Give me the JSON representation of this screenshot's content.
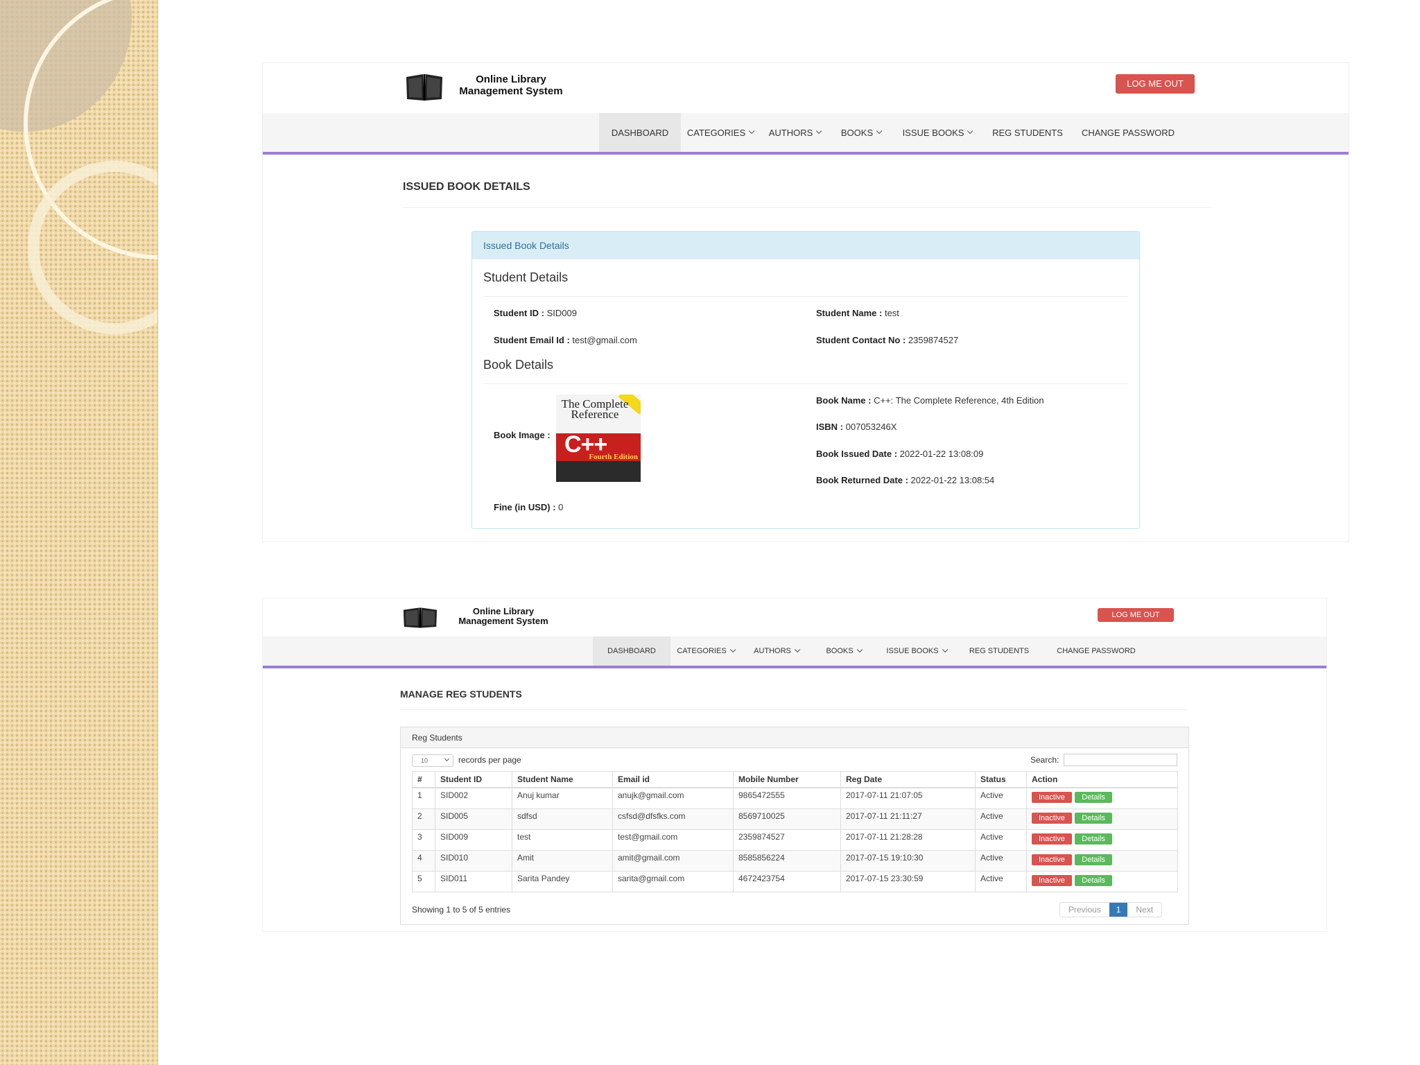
{
  "app": {
    "title_line1": "Online Library",
    "title_line2": "Management System",
    "logout_label": "LOG ME OUT"
  },
  "nav": {
    "dashboard": "DASHBOARD",
    "categories": "CATEGORIES",
    "authors": "AUTHORS",
    "books": "BOOKS",
    "issue_books": "ISSUE BOOKS",
    "reg_students": "REG STUDENTS",
    "change_password": "CHANGE PASSWORD"
  },
  "issued": {
    "page_title": "ISSUED BOOK DETAILS",
    "panel_heading": "Issued Book Details",
    "student_section": "Student Details",
    "book_section": "Book Details",
    "student_id_label": "Student ID :",
    "student_id": "SID009",
    "student_name_label": "Student Name :",
    "student_name": "test",
    "email_label": "Student Email Id :",
    "email": "test@gmail.com",
    "contact_label": "Student Contact No :",
    "contact": "2359874527",
    "book_image_label": "Book Image :",
    "book_name_label": "Book Name :",
    "book_name": "C++: The Complete Reference, 4th Edition",
    "isbn_label": "ISBN :",
    "isbn": "007053246X",
    "issued_date_label": "Book Issued Date :",
    "issued_date": "2022-01-22 13:08:09",
    "returned_date_label": "Book Returned Date :",
    "returned_date": "2022-01-22 13:08:54",
    "fine_label": "Fine (in USD) :",
    "fine": "0",
    "cover": {
      "title": "The Complete Reference",
      "big": "C++",
      "edition": "Fourth Edition"
    }
  },
  "manage": {
    "page_title": "MANAGE REG STUDENTS",
    "panel_heading": "Reg Students",
    "page_size": "10",
    "records_per_page": "records per page",
    "search_label": "Search:",
    "columns": [
      "#",
      "Student ID",
      "Student Name",
      "Email id",
      "Mobile Number",
      "Reg Date",
      "Status",
      "Action"
    ],
    "rows": [
      {
        "n": "1",
        "id": "SID002",
        "name": "Anuj kumar",
        "email": "anujk@gmail.com",
        "mobile": "9865472555",
        "date": "2017-07-11 21:07:05",
        "status": "Active"
      },
      {
        "n": "2",
        "id": "SID005",
        "name": "sdfsd",
        "email": "csfsd@dfsfks.com",
        "mobile": "8569710025",
        "date": "2017-07-11 21:11:27",
        "status": "Active"
      },
      {
        "n": "3",
        "id": "SID009",
        "name": "test",
        "email": "test@gmail.com",
        "mobile": "2359874527",
        "date": "2017-07-11 21:28:28",
        "status": "Active"
      },
      {
        "n": "4",
        "id": "SID010",
        "name": "Amit",
        "email": "amit@gmail.com",
        "mobile": "8585856224",
        "date": "2017-07-15 19:10:30",
        "status": "Active"
      },
      {
        "n": "5",
        "id": "SID011",
        "name": "Sarita Pandey",
        "email": "sarita@gmail.com",
        "mobile": "4672423754",
        "date": "2017-07-15 23:30:59",
        "status": "Active"
      }
    ],
    "inactive_label": "Inactive",
    "details_label": "Details",
    "showing": "Showing 1 to 5 of 5 entries",
    "prev": "Previous",
    "page": "1",
    "next": "Next"
  },
  "colors": {
    "logout": "#d9534f",
    "nav_border": "#9b7fd4",
    "info_panel": "#d9edf7",
    "success": "#5cb85c",
    "primary": "#337ab7"
  }
}
